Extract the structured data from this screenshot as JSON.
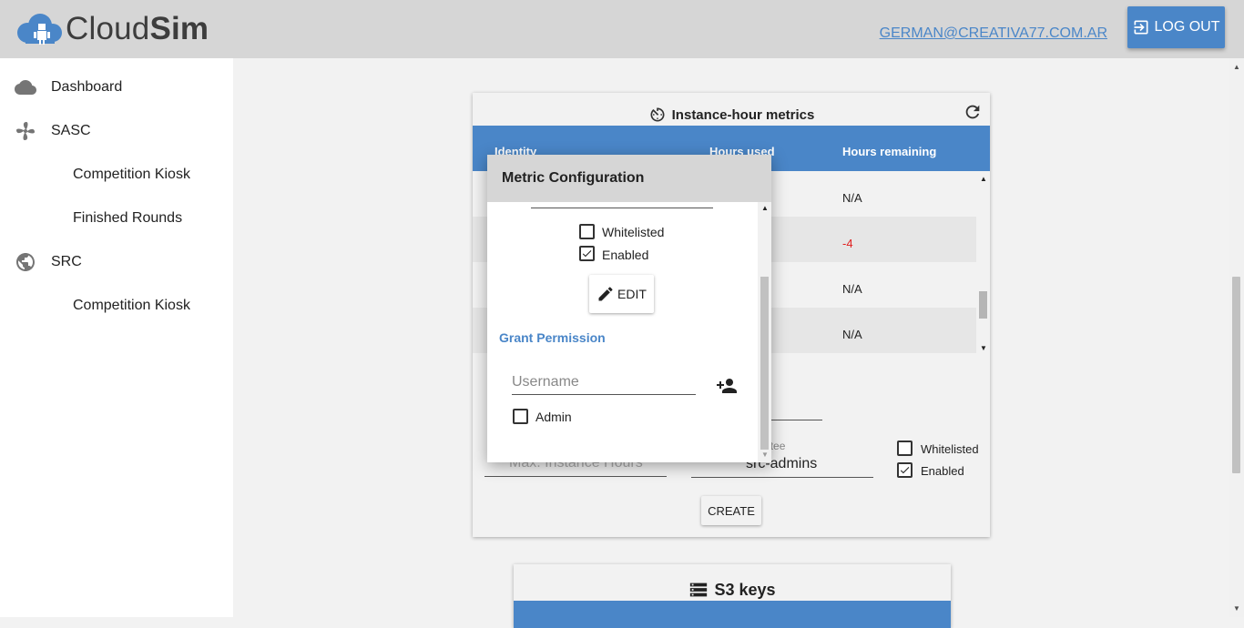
{
  "header": {
    "logo_text_light": "Cloud",
    "logo_text_bold": "Sim",
    "user_email": "GERMAN@CREATIVA77.COM.AR",
    "logout_label": "LOG OUT"
  },
  "sidebar": {
    "items": [
      {
        "label": "Dashboard",
        "icon": "cloud-icon"
      },
      {
        "label": "SASC",
        "icon": "fan-icon"
      },
      {
        "label": "Competition Kiosk"
      },
      {
        "label": "Finished Rounds"
      },
      {
        "label": "SRC",
        "icon": "globe-icon"
      },
      {
        "label": "Competition Kiosk"
      }
    ]
  },
  "metrics": {
    "title": "Instance-hour metrics",
    "columns": [
      "Identity",
      "Hours used",
      "Hours remaining"
    ],
    "rows": [
      {
        "remaining": "N/A"
      },
      {
        "remaining": "-4"
      },
      {
        "remaining": "N/A"
      },
      {
        "remaining": "N/A"
      }
    ],
    "max_hours_placeholder": "Max. Instance Hours",
    "grantee_label": "Permission grantee",
    "grantee_value": "src-admins",
    "whitelisted_label": "Whitelisted",
    "enabled_label": "Enabled",
    "create_label": "CREATE"
  },
  "s3": {
    "title": "S3 keys"
  },
  "dialog": {
    "title": "Metric Configuration",
    "whitelisted_label": "Whitelisted",
    "enabled_label": "Enabled",
    "edit_label": "EDIT",
    "grant_title": "Grant Permission",
    "username_placeholder": "Username",
    "admin_label": "Admin"
  },
  "colors": {
    "accent": "#4a86c8",
    "header_bg": "#d6d6d6",
    "negative": "#e02020"
  }
}
